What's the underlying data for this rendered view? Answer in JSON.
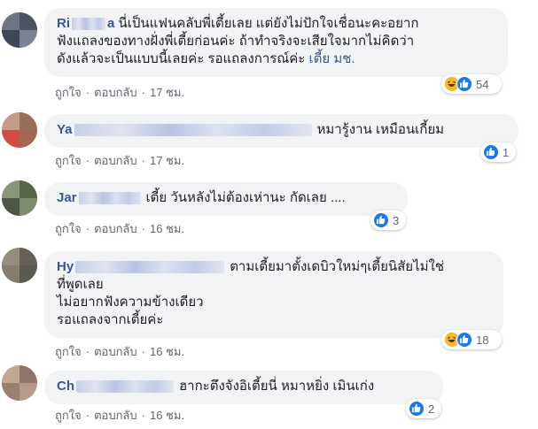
{
  "comments": [
    {
      "name_visible": "Ri",
      "name_visible_end": "a",
      "text": "นี่เป็นแฟนคลับพี่เตี้ยเลย แต่ยังไม่ปักใจเชื่อนะคะอยาก\nฟังแถลงของทางฝั่งพี่เตี้ยก่อนค่ะ ถ้าทำจริงจะเสียใจมากไม่คิดว่า\nดังแล้วจะเป็นแบบนี้เลยค่ะ รอแถลงการณ์ค่ะ ",
      "tag": "เตี้ย มช.",
      "like": "ถูกใจ",
      "reply": "ตอบกลับ",
      "time": "17 ชม.",
      "reaction_count": "54",
      "reaction_icons": [
        "haha-icon",
        "like-icon"
      ]
    },
    {
      "name_visible": "Ya",
      "text": "หมารู้งาน เหมือนเกี้ยม",
      "like": "ถูกใจ",
      "reply": "ตอบกลับ",
      "time": "17 ชม.",
      "reaction_count": "1",
      "reaction_icons": [
        "like-icon"
      ]
    },
    {
      "name_visible": "Jar",
      "text": "เตี้ย วันหลังไม่ต้องเห่านะ กัดเลย ....",
      "like": "ถูกใจ",
      "reply": "ตอบกลับ",
      "time": "16 ชม.",
      "reaction_count": "3",
      "reaction_icons": [
        "like-icon"
      ]
    },
    {
      "name_visible": "Hy",
      "text": "ตามเตี้ยมาตั้งเดบิวใหม่ๆเตี้ยนิสัยไม่ใช่\nที่พูดเลย\nไม่อยากฟังความข้างเดียว\nรอแถลงจากเตี้ยค่ะ",
      "like": "ถูกใจ",
      "reply": "ตอบกลับ",
      "time": "16 ชม.",
      "reaction_count": "18",
      "reaction_icons": [
        "haha-icon",
        "like-icon"
      ]
    },
    {
      "name_visible": "Ch",
      "text": "ฮากะตึงจังอิเตี้ยนี่ หมาหยิ่ง เมินเก่ง",
      "like": "ถูกใจ",
      "reply": "ตอบกลับ",
      "time": "16 ชม.",
      "reaction_count": "2",
      "reaction_icons": [
        "like-icon"
      ]
    }
  ],
  "colors": {
    "name_link": "#385898",
    "bubble": "#f2f3f5",
    "meta": "#606770",
    "like_blue": "#1877f2",
    "haha_yellow": "#f7b928"
  }
}
